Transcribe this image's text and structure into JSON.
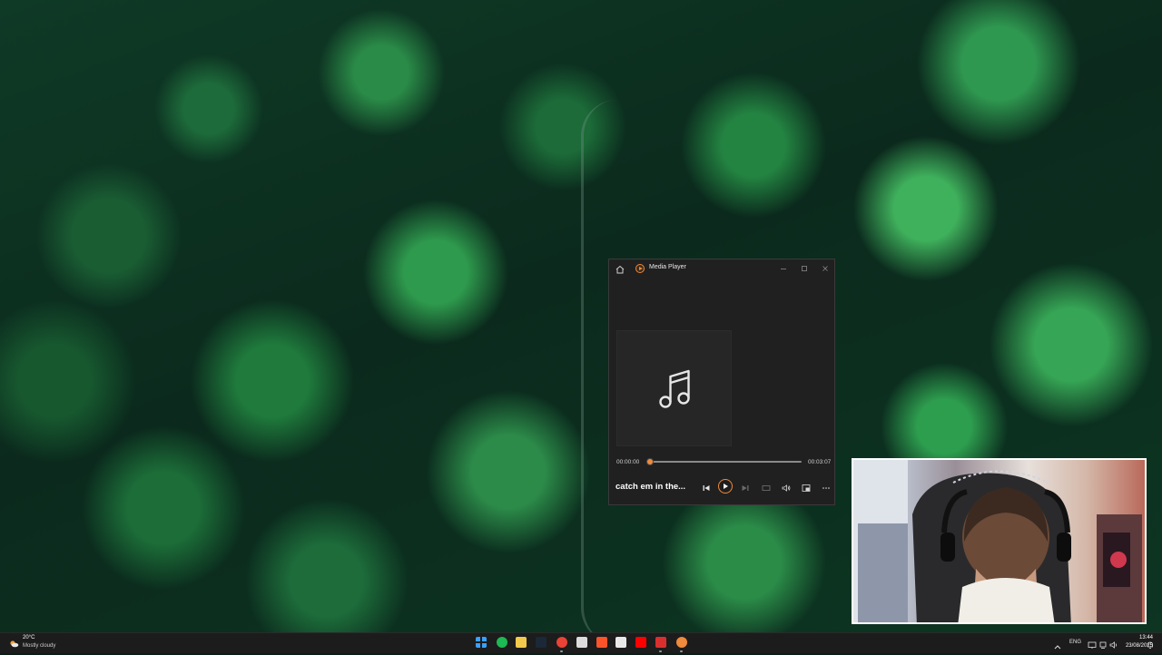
{
  "player": {
    "app_title": "Media Player",
    "icons": {
      "home": "home-icon",
      "app": "media-player-icon",
      "art": "music-note-icon",
      "previous": "previous-track-icon",
      "play": "play-icon",
      "next": "next-track-icon",
      "miniview": "miniview-icon",
      "volume": "volume-icon",
      "cast": "cast-icon",
      "more": "more-icon"
    },
    "time_current": "00:00:00",
    "time_total": "00:03:07",
    "progress_fraction": 0.02,
    "track_title": "catch em in the...",
    "accent_color": "#f08a3c"
  },
  "taskbar": {
    "weather": {
      "temp": "20°C",
      "condition": "Mostly cloudy",
      "icon": "weather-icon"
    },
    "pinned": [
      {
        "name": "start-button",
        "icon": "windows-icon",
        "color": "#3aa0ff"
      },
      {
        "name": "spotify",
        "icon": "spotify-icon",
        "color": "#1db954"
      },
      {
        "name": "file-explorer",
        "icon": "folder-icon",
        "color": "#f2c94c"
      },
      {
        "name": "steam",
        "icon": "steam-icon",
        "color": "#1b2838"
      },
      {
        "name": "chrome",
        "icon": "chrome-icon",
        "color": "#e84335"
      },
      {
        "name": "obs",
        "icon": "obs-icon",
        "color": "#dcdcdc"
      },
      {
        "name": "brave",
        "icon": "brave-icon",
        "color": "#fb542b"
      },
      {
        "name": "calendar",
        "icon": "calendar-icon",
        "color": "#e8e8e8"
      },
      {
        "name": "youtube",
        "icon": "youtube-icon",
        "color": "#ff0000"
      },
      {
        "name": "screen-recorder",
        "icon": "recorder-icon",
        "color": "#d9302f"
      },
      {
        "name": "media-player",
        "icon": "media-player-icon",
        "color": "#f08a3c"
      }
    ],
    "tray": {
      "language": "ENG",
      "icons": [
        "chevron-up-icon",
        "display-icon",
        "network-icon",
        "volume-icon",
        "notification-icon"
      ]
    },
    "clock": {
      "time": "13:44",
      "date": "23/08/2025"
    }
  }
}
